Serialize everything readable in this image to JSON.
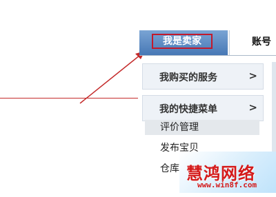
{
  "tabs": {
    "seller": "我是卖家",
    "account": "账号"
  },
  "sidebar": {
    "purchased_services": {
      "label": "我购买的服务",
      "chevron": ">"
    },
    "quick_menu": {
      "label": "我的快捷菜单",
      "chevron": ">"
    },
    "items": [
      "评价管理",
      "发布宝贝",
      "仓库"
    ]
  },
  "watermark": {
    "title": "慧鸿网络",
    "url": "www.win8f.com"
  },
  "colors": {
    "tab_active": "#4778b5",
    "highlight_border": "#c3192b",
    "arrow": "#c42a2a",
    "watermark": "#d41a1a"
  }
}
